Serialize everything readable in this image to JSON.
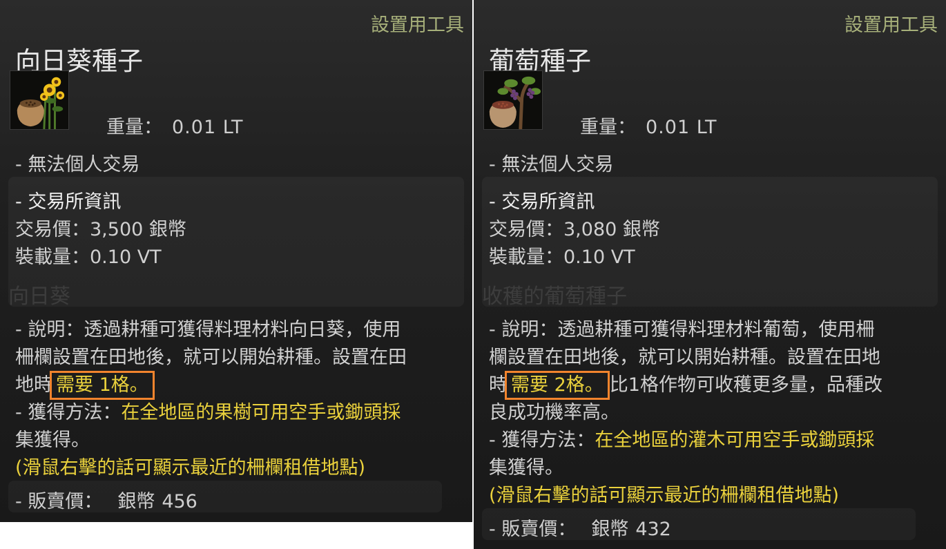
{
  "left": {
    "category": "設置用工具",
    "name": "向日葵種子",
    "icon": "sunflower-seed-icon",
    "weight_label": "重量：",
    "weight_value": "0.01 LT",
    "no_trade": "- 無法個人交易",
    "market_title": "- 交易所資訊",
    "market_price": "交易價：3,500 銀幣",
    "market_load": "裝載量：0.10 VT",
    "ghost_text": "向日葵",
    "desc_line1": "- 說明：透過耕種可獲得料理材料向日葵，使用",
    "desc_line2": "柵欄設置在田地後，就可以開始耕種。設置在田",
    "desc_line3_pre": "地時",
    "desc_line3_hl": "需要 1格。",
    "obtain_prefix": "- 獲得方法：",
    "obtain_line1_rest": "在全地區的果樹可用空手或鋤頭採",
    "obtain_line2": "集獲得。",
    "hint": "(滑鼠右擊的話可顯示最近的柵欄租借地點)",
    "sell_label": "- 販賣價：",
    "sell_coin": "銀幣",
    "sell_price": "456"
  },
  "right": {
    "category": "設置用工具",
    "name": "葡萄種子",
    "icon": "grape-seed-icon",
    "weight_label": "重量：",
    "weight_value": "0.01 LT",
    "no_trade": "- 無法個人交易",
    "market_title": "- 交易所資訊",
    "market_price": "交易價：3,080 銀幣",
    "market_load": "裝載量：0.10 VT",
    "ghost_text": "收穫的葡萄種子",
    "desc_line1": "- 說明：透過耕種可獲得料理材料葡萄，使用柵",
    "desc_line2": "欄設置在田地後，就可以開始耕種。設置在田地",
    "desc_line3_pre": "時",
    "desc_line3_hl": "需要 2格。",
    "desc_line3_post": "比1格作物可收穫更多量，品種改",
    "desc_line4": "良成功機率高。",
    "obtain_prefix": "- 獲得方法：",
    "obtain_line1_rest": "在全地區的灌木可用空手或鋤頭採",
    "obtain_line2": "集獲得。",
    "hint": "(滑鼠右擊的話可顯示最近的柵欄租借地點)",
    "sell_label": "- 販賣價：",
    "sell_coin": "銀幣",
    "sell_price": "432"
  },
  "colors": {
    "background": "#1f1f1f",
    "category": "#a7b07a",
    "text": "#d0d0d0",
    "highlight_text": "#ead13c",
    "highlight_box": "#f2842d"
  }
}
